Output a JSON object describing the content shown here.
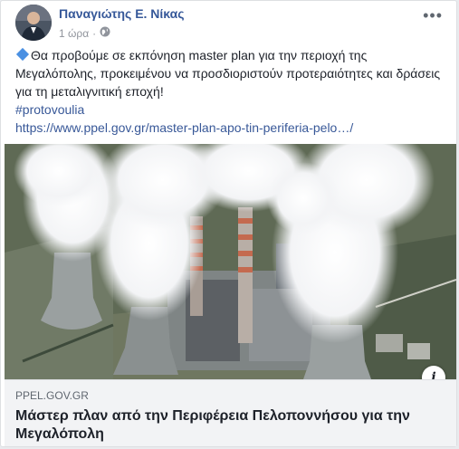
{
  "post": {
    "author": "Παναγιώτης Ε. Νίκας",
    "time": "1 ώρα",
    "privacy_icon": "globe-icon",
    "menu_icon": "more-options-icon",
    "text": "Θα προβούμε σε εκπόνηση master plan για την περιοχή της Μεγαλόπολης, προκειμένου να προσδιοριστούν προτεραιότητες και δράσεις για τη μεταλιγνιτική εποχή!",
    "hashtag": "#protovoulia",
    "url": "https://www.ppel.gov.gr/master-plan-apo-tin-periferia-pelo…/"
  },
  "link": {
    "domain": "PPEL.GOV.GR",
    "title": "Μάστερ πλαν από την Περιφέρεια Πελοποννήσου για την Μεγαλόπολη"
  },
  "colors": {
    "author_link": "#365899",
    "link": "#385898",
    "text": "#1d2129",
    "meta": "#90949c"
  }
}
